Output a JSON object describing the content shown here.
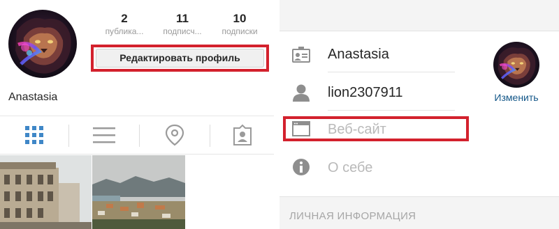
{
  "profile": {
    "username": "Anastasia",
    "stats": [
      {
        "value": "2",
        "label": "публика..."
      },
      {
        "value": "11",
        "label": "подписч..."
      },
      {
        "value": "10",
        "label": "подписки"
      }
    ],
    "edit_button": "Редактировать профиль"
  },
  "tabs": [
    {
      "name": "grid",
      "icon": "grid-icon"
    },
    {
      "name": "list",
      "icon": "list-icon"
    },
    {
      "name": "map",
      "icon": "location-pin-icon"
    },
    {
      "name": "tagged",
      "icon": "tagged-person-icon"
    }
  ],
  "edit_form": {
    "fields": [
      {
        "icon": "id-card-icon",
        "value": "Anastasia",
        "placeholder": ""
      },
      {
        "icon": "person-icon",
        "value": "lion2307911",
        "placeholder": ""
      },
      {
        "icon": "browser-window-icon",
        "value": "",
        "placeholder": "Веб-сайт"
      },
      {
        "icon": "info-icon",
        "value": "",
        "placeholder": "О себе"
      }
    ],
    "change_photo": "Изменить",
    "section_title": "ЛИЧНАЯ ИНФОРМАЦИЯ"
  },
  "colors": {
    "highlight": "#d3212d",
    "link": "#125688",
    "grid_active": "#3f87c7",
    "icon_gray": "#8e8e8e"
  }
}
